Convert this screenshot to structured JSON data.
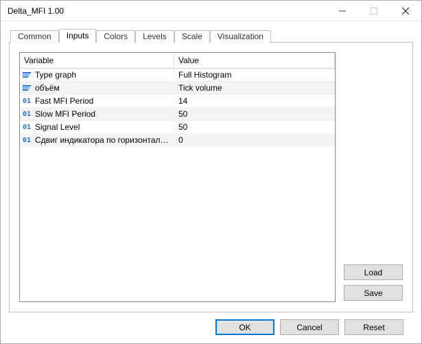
{
  "window": {
    "title": "Delta_MFI 1.00"
  },
  "tabs": {
    "items": [
      {
        "label": "Common"
      },
      {
        "label": "Inputs"
      },
      {
        "label": "Colors"
      },
      {
        "label": "Levels"
      },
      {
        "label": "Scale"
      },
      {
        "label": "Visualization"
      }
    ],
    "active_index": 1
  },
  "grid": {
    "header_variable": "Variable",
    "header_value": "Value",
    "rows": [
      {
        "icon": "enum",
        "variable": "Type graph",
        "value": "Full Histogram"
      },
      {
        "icon": "enum",
        "variable": "объём",
        "value": "Tick volume"
      },
      {
        "icon": "int",
        "variable": "Fast MFI Period",
        "value": "14"
      },
      {
        "icon": "int",
        "variable": "Slow MFI Period",
        "value": "50"
      },
      {
        "icon": "int",
        "variable": "Signal Level",
        "value": "50"
      },
      {
        "icon": "int",
        "variable": "Сдвиг индикатора по горизонтали в ...",
        "value": "0"
      }
    ]
  },
  "buttons": {
    "load": "Load",
    "save": "Save",
    "ok": "OK",
    "cancel": "Cancel",
    "reset": "Reset"
  },
  "icons": {
    "int_label": "01"
  }
}
